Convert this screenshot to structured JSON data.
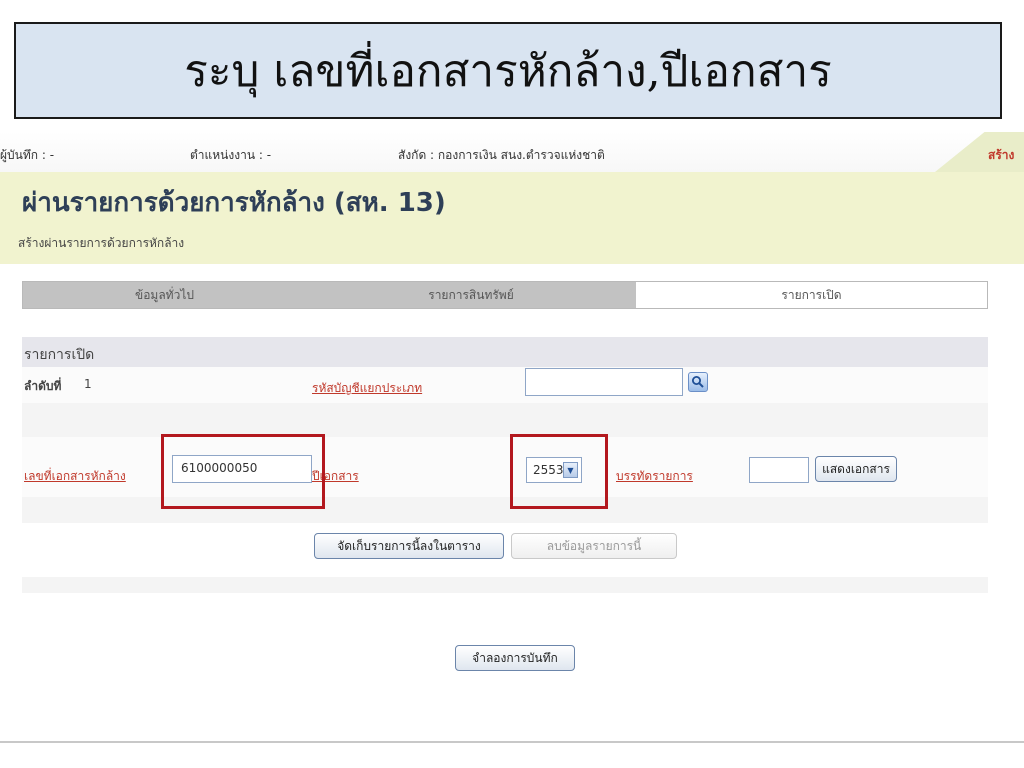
{
  "slide": {
    "title": "ระบุ เลขที่เอกสารหักล้าง,ปีเอกสาร"
  },
  "infobar": {
    "recorder": "ผู้บันทึก : -",
    "position": "ตำแหน่งงาน : -",
    "agency": "สังกัด : กองการเงิน สนง.ตำรวจแห่งชาติ",
    "create_link": "สร้าง"
  },
  "page": {
    "title": "ผ่านรายการด้วยการหักล้าง (สห. 13)",
    "subtitle": "สร้างผ่านรายการด้วยการหักล้าง"
  },
  "tabs": [
    {
      "label": "ข้อมูลทั่วไป",
      "active": false
    },
    {
      "label": "รายการสินทรัพย์",
      "active": false
    },
    {
      "label": "รายการเปิด",
      "active": true
    }
  ],
  "form": {
    "section_title": "รายการเปิด",
    "seq_label": "ลำดับที่",
    "seq_value": "1",
    "account_code_label": "รหัสบัญชีแยกประเภท",
    "account_code_value": "",
    "doc_no_label": "เลขที่เอกสารหักล้าง",
    "doc_no_value": "6100000050",
    "doc_year_label": "ปีเอกสาร",
    "doc_year_value": "2553",
    "line_item_label": "บรรทัดรายการ",
    "line_item_value": "",
    "show_doc_button": "แสดงเอกสาร",
    "save_row_button": "จัดเก็บรายการนี้ลงในตาราง",
    "delete_row_button": "ลบข้อมูลรายการนี้"
  },
  "footer": {
    "simulate_button": "จำลองการบันทึก"
  },
  "colors": {
    "title_box": "#d9e4f1",
    "header_band": "#f1f3cf",
    "highlight": "#b3181e",
    "link_red": "#c0392b",
    "page_title": "#2e3f57"
  }
}
